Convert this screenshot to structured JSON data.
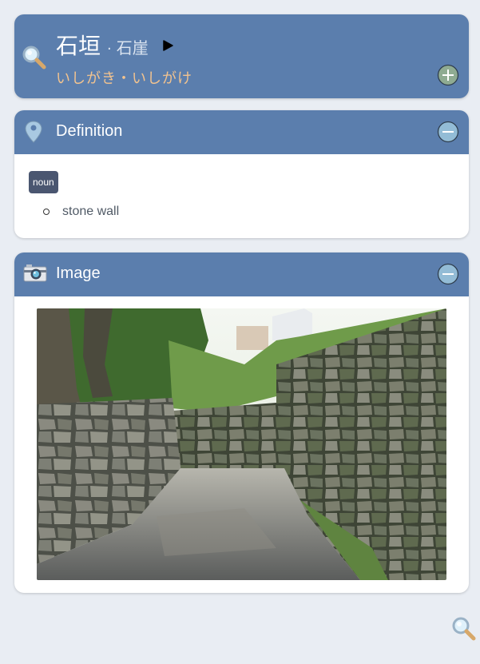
{
  "entry": {
    "word": "石垣",
    "separator": "·",
    "alt_form": "石崖",
    "reading": "いしがき・いしがけ",
    "icons": {
      "search": "search-icon",
      "play": "play-icon",
      "add": "add-icon"
    }
  },
  "definition": {
    "title": "Definition",
    "icon": "map-pin-icon",
    "part_of_speech": "noun",
    "glosses": [
      "stone wall"
    ]
  },
  "image_section": {
    "title": "Image",
    "icon": "camera-icon",
    "image_alt": "stone wall path"
  },
  "colors": {
    "header_blue": "#5b7ead",
    "reading_orange": "#f2c38f",
    "badge": "#4a5670",
    "background": "#e9edf3"
  }
}
